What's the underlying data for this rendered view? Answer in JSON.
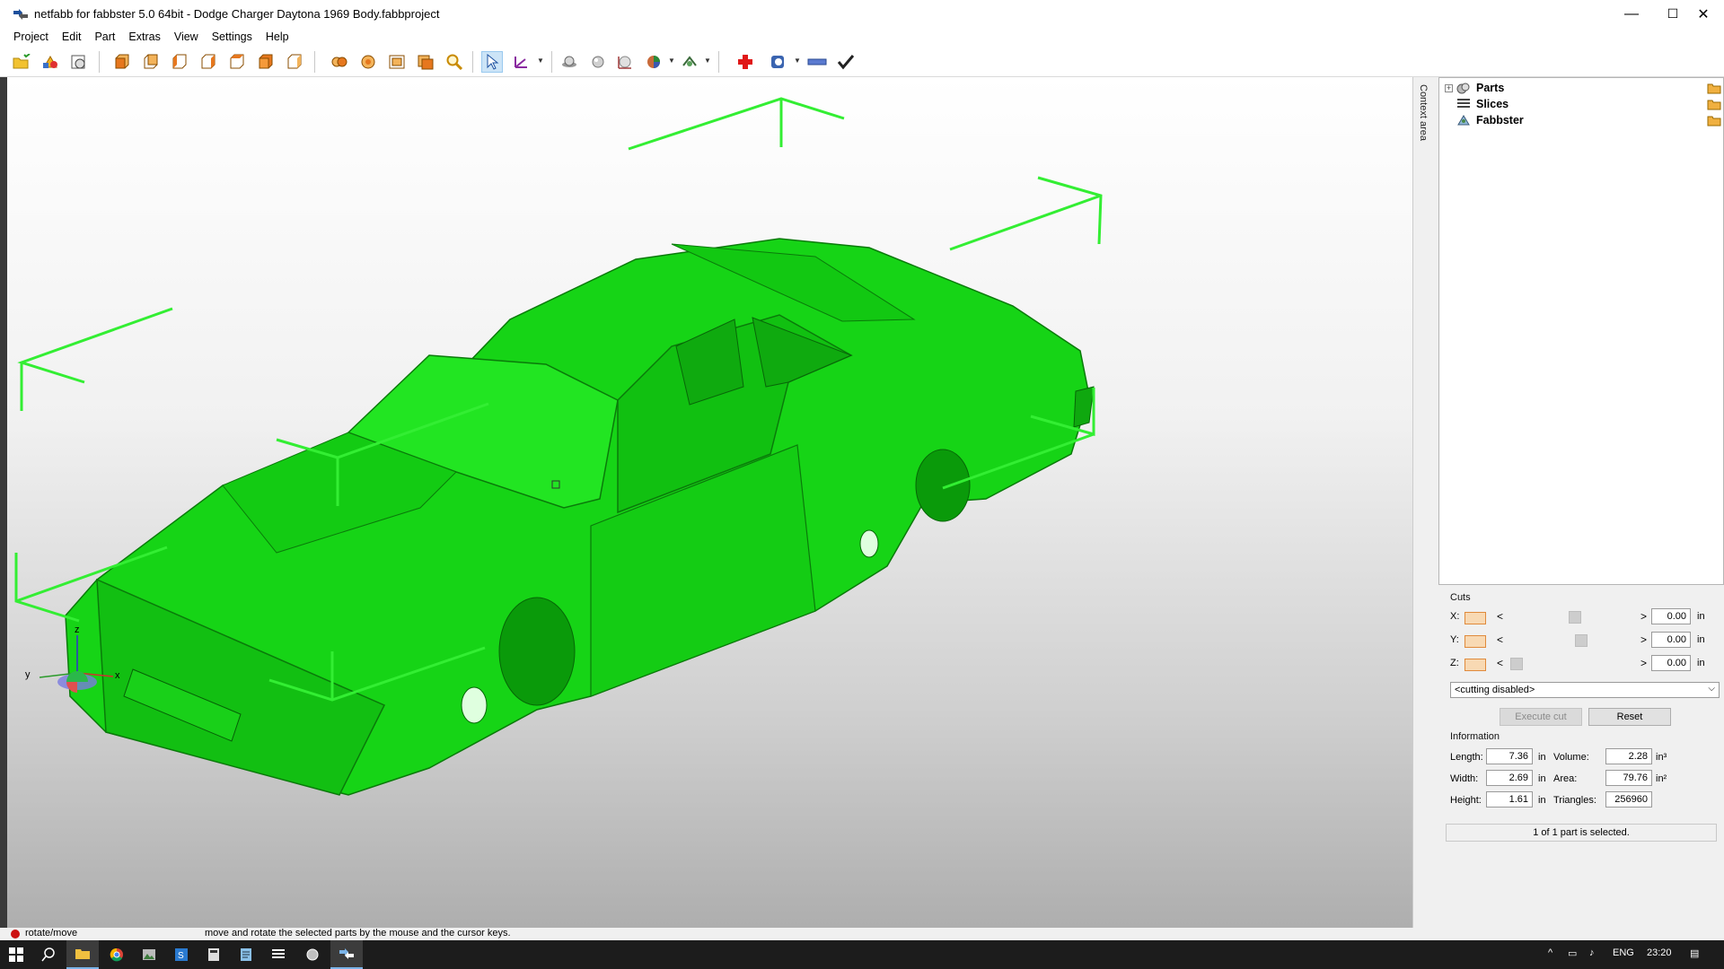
{
  "window": {
    "title": "netfabb for fabbster 5.0 64bit - Dodge Charger Daytona 1969 Body.fabbproject",
    "minimize": "—",
    "maximize": "☐",
    "close": "✕"
  },
  "menu": [
    "Project",
    "Edit",
    "Part",
    "Extras",
    "View",
    "Settings",
    "Help"
  ],
  "toolbar": {
    "icons": [
      "open-project-icon",
      "add-part-icon",
      "view-info-icon",
      "view-front-icon",
      "view-back-icon",
      "view-left-icon",
      "view-right-icon",
      "view-top-icon",
      "view-bottom-icon",
      "view-iso-icon",
      "zoom-all-icon",
      "zoom-selection-icon",
      "zoom-box-icon",
      "zoom-parts-icon",
      "magnifier-icon",
      "select-pointer-icon",
      "move-axes-icon",
      "shading-icon",
      "sphere-icon",
      "measure-icon",
      "color-wheel-icon",
      "view-mode-icon",
      "repair-icon",
      "support-icon",
      "ruler-icon",
      "check-icon"
    ]
  },
  "viewport": {
    "axis_labels": {
      "x": "x",
      "y": "y",
      "z": "z"
    },
    "model_color": "#16d416",
    "cage_color": "#33ee33"
  },
  "side_tab": {
    "label": "Context area"
  },
  "tree": {
    "items": [
      {
        "label": "Parts",
        "icon": "parts-icon",
        "expandable": true
      },
      {
        "label": "Slices",
        "icon": "slices-icon",
        "expandable": false
      },
      {
        "label": "Fabbster",
        "icon": "fabbster-printer-icon",
        "expandable": false
      }
    ]
  },
  "cuts": {
    "title": "Cuts",
    "rows": [
      {
        "axis": "X:",
        "value": "0.00",
        "unit": "in",
        "level": 0.5
      },
      {
        "axis": "Y:",
        "value": "0.00",
        "unit": "in",
        "level": 0.55
      },
      {
        "axis": "Z:",
        "value": "0.00",
        "unit": "in",
        "level": 0.02
      }
    ],
    "mode": "<cutting disabled>",
    "execute_label": "Execute cut",
    "reset_label": "Reset"
  },
  "information": {
    "title": "Information",
    "length_label": "Length:",
    "length": "7.36",
    "length_unit": "in",
    "width_label": "Width:",
    "width": "2.69",
    "width_unit": "in",
    "height_label": "Height:",
    "height": "1.61",
    "height_unit": "in",
    "volume_label": "Volume:",
    "volume": "2.28",
    "volume_unit": "in³",
    "area_label": "Area:",
    "area": "79.76",
    "area_unit": "in²",
    "triangles_label": "Triangles:",
    "triangles": "256960",
    "selection_status": "1 of 1 part is selected."
  },
  "statusbar": {
    "mode": "rotate/move",
    "message": "move and rotate the selected parts by the mouse and the cursor keys."
  },
  "taskbar": {
    "apps": [
      "start-icon",
      "search-icon",
      "file-explorer-icon",
      "chrome-icon",
      "photos-icon",
      "app-s-icon",
      "calculator-icon",
      "notepad-icon",
      "list-app-icon",
      "netfabb-icon",
      "netfabb-active-icon"
    ],
    "language": "ENG",
    "time": "23:20"
  }
}
